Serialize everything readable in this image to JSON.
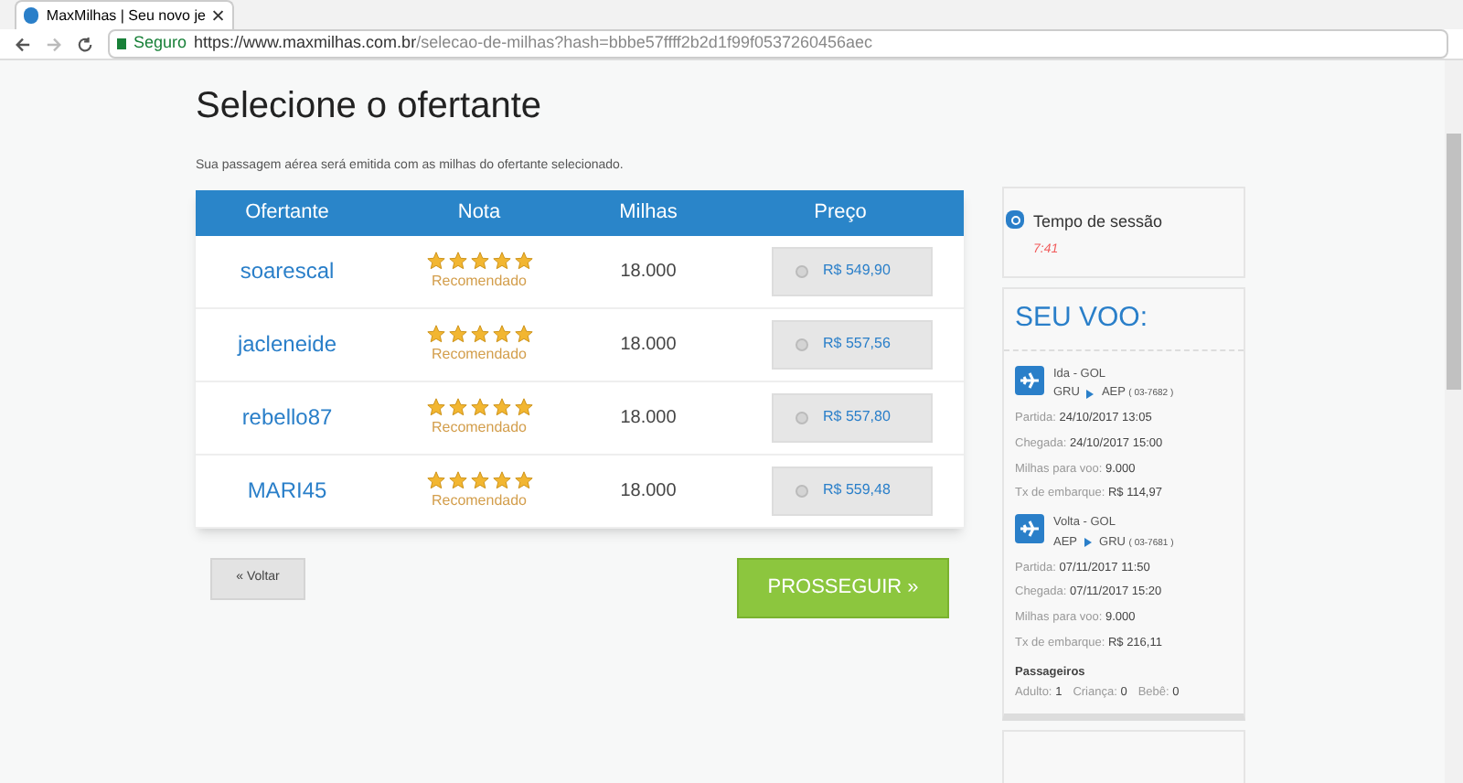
{
  "browser": {
    "tab_title": "MaxMilhas | Seu novo je",
    "secure_label": "Seguro",
    "url_host": "https://www.maxmilhas.com.br",
    "url_path": "/selecao-de-milhas?hash=bbbe57ffff2b2d1f99f0537260456aec"
  },
  "page": {
    "title": "Selecione o ofertante",
    "subtitle": "Sua passagem aérea será emitida com as milhas do ofertante selecionado.",
    "columns": [
      "Ofertante",
      "Nota",
      "Milhas",
      "Preço"
    ],
    "offers": [
      {
        "seller": "soarescal",
        "stars": 5,
        "rating_label": "Recomendado",
        "miles": "18.000",
        "price": "R$ 549,90",
        "selected": false
      },
      {
        "seller": "jacleneide",
        "stars": 5,
        "rating_label": "Recomendado",
        "miles": "18.000",
        "price": "R$ 557,56",
        "selected": false
      },
      {
        "seller": "rebello87",
        "stars": 5,
        "rating_label": "Recomendado",
        "miles": "18.000",
        "price": "R$ 557,80",
        "selected": false
      },
      {
        "seller": "MARI45",
        "stars": 5,
        "rating_label": "Recomendado",
        "miles": "18.000",
        "price": "R$ 559,48",
        "selected": false
      }
    ],
    "back_button": "« Voltar",
    "continue_button": "PROSSEGUIR »"
  },
  "sidebar": {
    "session": {
      "label": "Tempo de sessão",
      "time": "7:41"
    },
    "flight_title": "SEU VOO:",
    "legs": [
      {
        "title": "Ida - GOL",
        "from": "GRU",
        "to": "AEP",
        "code": "( 03-7682 )",
        "details": [
          {
            "label": "Partida:",
            "value": "24/10/2017 13:05"
          },
          {
            "label": "Chegada:",
            "value": "24/10/2017 15:00"
          },
          {
            "label": "Milhas para voo:",
            "value": "9.000"
          },
          {
            "label": "Tx de embarque:",
            "value": "R$ 114,97"
          }
        ]
      },
      {
        "title": "Volta - GOL",
        "from": "AEP",
        "to": "GRU",
        "code": "( 03-7681 )",
        "details": [
          {
            "label": "Partida:",
            "value": "07/11/2017 11:50"
          },
          {
            "label": "Chegada:",
            "value": "07/11/2017 15:20"
          },
          {
            "label": "Milhas para voo:",
            "value": "9.000"
          },
          {
            "label": "Tx de embarque:",
            "value": "R$ 216,11"
          }
        ]
      }
    ],
    "passengers_title": "Passageiros",
    "passengers": [
      {
        "label": "Adulto:",
        "value": "1"
      },
      {
        "label": "Criança:",
        "value": "0"
      },
      {
        "label": "Bebê:",
        "value": "0"
      }
    ]
  }
}
